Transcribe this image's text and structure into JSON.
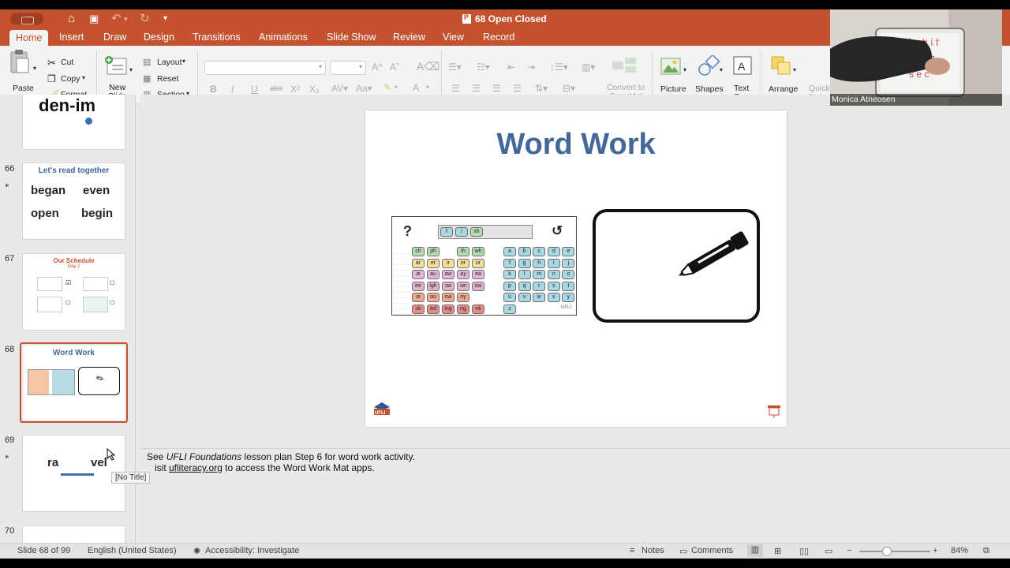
{
  "window": {
    "title": "68 Open Closed"
  },
  "tabs": [
    "Home",
    "Insert",
    "Draw",
    "Design",
    "Transitions",
    "Animations",
    "Slide Show",
    "Review",
    "View",
    "Record"
  ],
  "ribbon": {
    "paste": "Paste",
    "cut": "Cut",
    "copy": "Copy",
    "format": "Format",
    "new_slide": "New\nSlide",
    "layout": "Layout",
    "reset": "Reset",
    "section": "Section",
    "font_buttons": [
      "B",
      "I",
      "U",
      "abc",
      "X²",
      "X₂"
    ],
    "convert_smartart": "Convert to\nSmartArt",
    "picture": "Picture",
    "shapes": "Shapes",
    "text_box": "Text\nBox",
    "arrange": "Arrange",
    "quick_styles": "Quick\nStyles"
  },
  "thumbnails": [
    {
      "num": "",
      "text": "den-im",
      "starred": false
    },
    {
      "num": "66",
      "title": "Let's read together",
      "words": [
        "began",
        "even",
        "open",
        "begin"
      ],
      "starred": true
    },
    {
      "num": "67",
      "title": "Our Schedule",
      "subtitle": "Day 2",
      "starred": false
    },
    {
      "num": "68",
      "title": "Word Work",
      "starred": false,
      "selected": true
    },
    {
      "num": "69",
      "words": [
        "ra",
        "vel"
      ],
      "starred": true
    },
    {
      "num": "70",
      "starred": true
    }
  ],
  "tooltip": "[No Title]",
  "slide": {
    "title": "Word Work",
    "mat_top": [
      "?",
      "f",
      "i",
      "sh",
      "↺"
    ],
    "mat_vowel_keys": [
      [
        "ch",
        "ph",
        "",
        "th",
        "wh"
      ],
      [
        "ar",
        "er",
        "ir",
        "or",
        "ur"
      ],
      [
        "ai",
        "au",
        "aw",
        "ay",
        "ea"
      ],
      [
        "ee",
        "igh",
        "oa",
        "oe",
        "ow"
      ],
      [
        "oi",
        "ou",
        "ow",
        "oy",
        ""
      ],
      [
        "ck",
        "ed",
        "ing",
        "ng",
        "nk"
      ]
    ],
    "mat_letter_keys": [
      [
        "a",
        "b",
        "c",
        "d",
        "e"
      ],
      [
        "f",
        "g",
        "h",
        "i",
        "j"
      ],
      [
        "k",
        "l",
        "m",
        "n",
        "o"
      ],
      [
        "p",
        "q",
        "r",
        "s",
        "t"
      ],
      [
        "u",
        "v",
        "w",
        "x",
        "y"
      ],
      [
        "z",
        "",
        "",
        "",
        ""
      ]
    ],
    "logo": "UFLI"
  },
  "notes": {
    "line1_prefix": "See ",
    "line1_em": "UFLI Foundations",
    "line1_suffix": " lesson plan Step 6 for word work activity.",
    "line2_prefix": "isit ",
    "line2_link": "ufliteracy.org",
    "line2_suffix": " to access the Word Work Mat apps."
  },
  "status": {
    "slide": "Slide 68 of 99",
    "language": "English (United States)",
    "accessibility": "Accessibility: Investigate",
    "notes": "Notes",
    "comments": "Comments",
    "zoom": "84%"
  },
  "webcam": {
    "name": "Monica Atneosen"
  },
  "colors": {
    "accent": "#c5522f",
    "title_blue": "#44679a"
  }
}
